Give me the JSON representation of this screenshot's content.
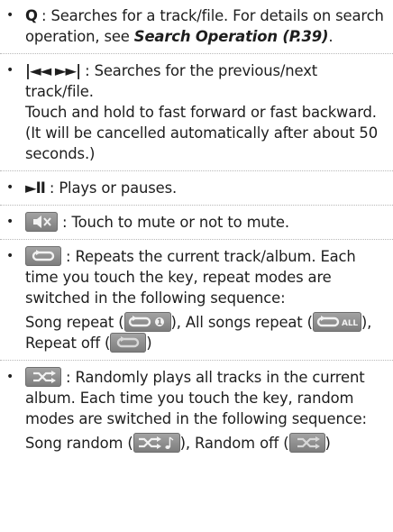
{
  "items": [
    {
      "key_label": "Q",
      "sep": " : ",
      "text": "Searches for a track/file. For details on search operation, see ",
      "ref": "Search Operation (P.39)",
      "end": "."
    },
    {
      "key_label": "|◄◄ ►►|",
      "sep": " : ",
      "text": "Searches for the previous/next track/file.",
      "text2": "Touch and hold to fast forward or fast backward. (It will be cancelled automatically after about 50 seconds.)"
    },
    {
      "key_label": "►II",
      "sep": " : ",
      "text": "Plays or pauses."
    },
    {
      "icon": "mute-key-icon",
      "sep": " : ",
      "text": "Touch to mute or not to mute."
    },
    {
      "icon": "repeat-key-icon",
      "sep": " : ",
      "text": "Repeats the current track/album. Each time you touch the key, repeat modes are switched in the following sequence:",
      "seq": [
        {
          "label": "Song repeat (",
          "icon": "repeat-one-icon",
          "close": "),"
        },
        {
          "label": " All songs repeat (",
          "icon": "repeat-all-icon",
          "close": "),"
        },
        {
          "label": " Repeat off (",
          "icon": "repeat-off-icon",
          "close": ")"
        }
      ],
      "all_text": "ALL",
      "one_text": "1"
    },
    {
      "icon": "random-key-icon",
      "sep": " : ",
      "text": "Randomly plays all tracks in the current album. Each time you touch the key, random modes are switched in the following sequence:",
      "seq": [
        {
          "label": "Song random (",
          "icon": "random-song-icon",
          "close": "),"
        },
        {
          "label": " Random off (",
          "icon": "random-off-icon",
          "close": ")"
        }
      ]
    }
  ]
}
